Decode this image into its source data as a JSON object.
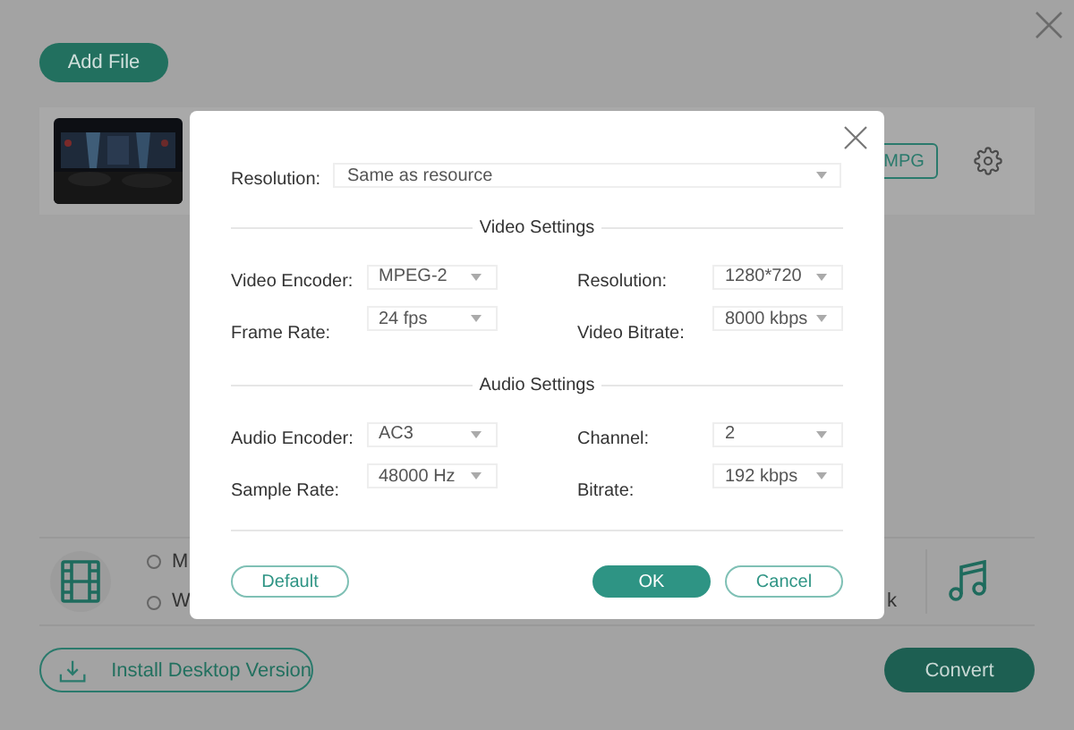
{
  "toolbar": {
    "add_button": "Add File"
  },
  "file_item": {
    "format_button": "MPG"
  },
  "output_panel": {
    "radios": [
      {
        "label": "M",
        "selected": false
      },
      {
        "label": "W",
        "selected": false
      }
    ],
    "trailing_text": "k"
  },
  "footer": {
    "install_button": "Install Desktop Version",
    "convert_button": "Convert"
  },
  "dialog": {
    "resolution": {
      "label": "Resolution:",
      "value": "Same as resource"
    },
    "sections": [
      {
        "title": "Video Settings",
        "fields": [
          {
            "label": "Video Encoder:",
            "value": "MPEG-2"
          },
          {
            "label": "Resolution:",
            "value": "1280*720"
          },
          {
            "label": "Frame Rate:",
            "value": "24 fps"
          },
          {
            "label": "Video Bitrate:",
            "value": "8000 kbps"
          }
        ]
      },
      {
        "title": "Audio Settings",
        "fields": [
          {
            "label": "Audio Encoder:",
            "value": "AC3"
          },
          {
            "label": "Channel:",
            "value": "2"
          },
          {
            "label": "Sample Rate:",
            "value": "48000 Hz"
          },
          {
            "label": "Bitrate:",
            "value": "192 kbps"
          }
        ]
      }
    ],
    "buttons": [
      {
        "label": "Default",
        "kind": "outline"
      },
      {
        "label": "OK",
        "kind": "primary"
      },
      {
        "label": "Cancel",
        "kind": "outline"
      }
    ]
  }
}
